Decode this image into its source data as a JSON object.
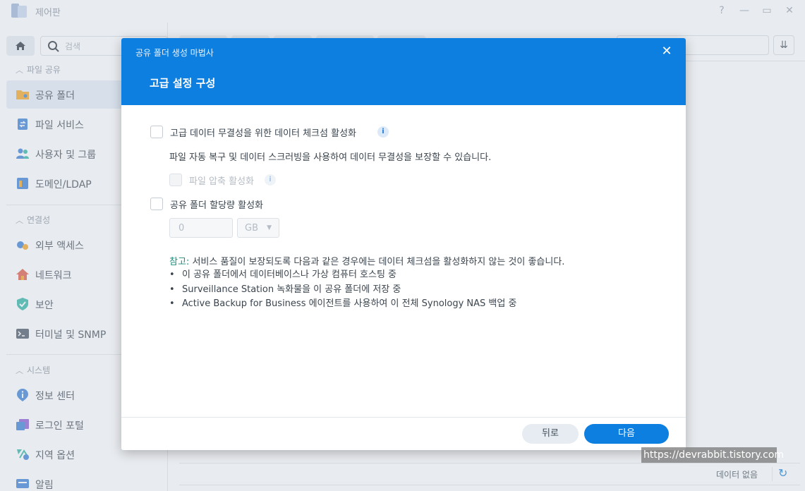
{
  "window": {
    "title": "제어판",
    "help": "?",
    "minimize": "—",
    "maximize": "▭",
    "close": "✕"
  },
  "sidebar": {
    "search_placeholder": "검색",
    "sections": [
      {
        "title": "파일 공유",
        "items": [
          {
            "label": "공유 폴더",
            "icon": "shared-folder-icon"
          },
          {
            "label": "파일 서비스",
            "icon": "file-services-icon"
          },
          {
            "label": "사용자 및 그룹",
            "icon": "users-icon"
          },
          {
            "label": "도메인/LDAP",
            "icon": "domain-icon"
          }
        ]
      },
      {
        "title": "연결성",
        "items": [
          {
            "label": "외부 액세스",
            "icon": "external-access-icon"
          },
          {
            "label": "네트워크",
            "icon": "network-icon"
          },
          {
            "label": "보안",
            "icon": "shield-icon"
          },
          {
            "label": "터미널 및 SNMP",
            "icon": "terminal-icon"
          }
        ]
      },
      {
        "title": "시스템",
        "items": [
          {
            "label": "정보 센터",
            "icon": "info-icon"
          },
          {
            "label": "로그인 포털",
            "icon": "login-portal-icon"
          },
          {
            "label": "지역 옵션",
            "icon": "regional-icon"
          },
          {
            "label": "알림",
            "icon": "notification-icon"
          }
        ]
      }
    ]
  },
  "background": {
    "no_data": "데이터 없음"
  },
  "wizard": {
    "title": "공유 폴더 생성 마법사",
    "step_title": "고급 설정 구성",
    "checksum": {
      "label": "고급 데이터 무결성을 위한 데이터 체크섬 활성화",
      "checked": false
    },
    "checksum_desc": "파일 자동 복구 및 데이터 스크러빙을 사용하여 데이터 무결성을 보장할 수 있습니다.",
    "compression": {
      "label": "파일 압축 활성화",
      "checked": false,
      "disabled": true
    },
    "quota": {
      "label": "공유 폴더 할당량 활성화",
      "checked": false,
      "value": "0",
      "unit": "GB"
    },
    "note_prefix": "참고:",
    "note_text": " 서비스 품질이 보장되도록 다음과 같은 경우에는 데이터 체크섬을 활성화하지 않는 것이 좋습니다.",
    "bullets": [
      "이 공유 폴더에서 데이터베이스나 가상 컴퓨터 호스팅 중",
      "Surveillance Station 녹화물을 이 공유 폴더에 저장 중",
      "Active Backup for Business 에이전트를 사용하여 이 전체 Synology NAS 백업 중"
    ],
    "back_label": "뒤로",
    "next_label": "다음"
  },
  "watermark": "https://devrabbit.tistory.com",
  "colors": {
    "accent": "#0c7fe0",
    "sidebar_active": "#e4edf7",
    "note_prefix": "#1a8c7a"
  }
}
